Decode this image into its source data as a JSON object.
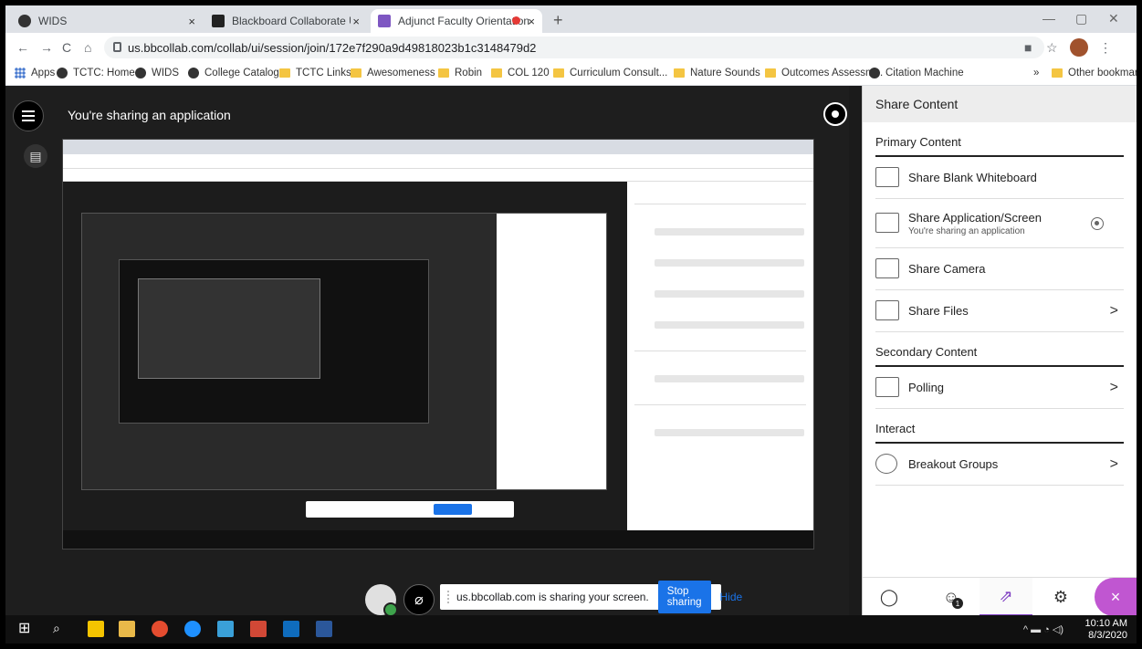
{
  "browser": {
    "tabs": [
      {
        "label": "WIDS",
        "icon": "globe-icon"
      },
      {
        "label": "Blackboard Collaborate Ultra - A",
        "icon": "blackboard-icon"
      },
      {
        "label": "Adjunct Faculty Orientation",
        "icon": "collaborate-icon"
      }
    ],
    "new_tab": "+",
    "url": "us.bbcollab.com/collab/ui/session/join/172e7f290a9d49818023b1c3148479d2",
    "bookmarks": [
      {
        "label": "Apps",
        "type": "apps"
      },
      {
        "label": "TCTC: Home",
        "type": "globe"
      },
      {
        "label": "WIDS",
        "type": "globe"
      },
      {
        "label": "College Catalog",
        "type": "globe"
      },
      {
        "label": "TCTC Links",
        "type": "folder"
      },
      {
        "label": "Awesomeness",
        "type": "folder"
      },
      {
        "label": "Robin",
        "type": "folder"
      },
      {
        "label": "COL 120",
        "type": "folder"
      },
      {
        "label": "Curriculum Consult...",
        "type": "folder"
      },
      {
        "label": "Nature Sounds",
        "type": "folder"
      },
      {
        "label": "Outcomes Assessm...",
        "type": "folder"
      },
      {
        "label": "Citation Machine",
        "type": "globe"
      }
    ],
    "bookmarks_more": "»",
    "other_bookmarks": "Other bookmarks"
  },
  "session": {
    "sharing_title": "You're sharing an application",
    "share_bar": {
      "message": "us.bbcollab.com is sharing your screen.",
      "stop_label": "Stop sharing",
      "hide_label": "Hide"
    }
  },
  "panel": {
    "title": "Share Content",
    "sections": [
      {
        "heading": "Primary Content",
        "items": [
          {
            "label": "Share Blank Whiteboard",
            "sub": "",
            "chevron": ""
          },
          {
            "label": "Share Application/Screen",
            "sub": "You're sharing an application",
            "chevron": ""
          },
          {
            "label": "Share Camera",
            "sub": "",
            "chevron": ""
          },
          {
            "label": "Share Files",
            "sub": "",
            "chevron": ">"
          }
        ]
      },
      {
        "heading": "Secondary Content",
        "items": [
          {
            "label": "Polling",
            "sub": "",
            "chevron": ">"
          }
        ]
      },
      {
        "heading": "Interact",
        "items": [
          {
            "label": "Breakout Groups",
            "sub": "",
            "chevron": ">"
          }
        ]
      }
    ],
    "footer": {
      "badge": "1",
      "close": "×"
    }
  },
  "taskbar": {
    "time": "10:10 AM",
    "date": "8/3/2020"
  },
  "colors": {
    "accent": "#c056d1",
    "blue": "#1a73e8"
  }
}
